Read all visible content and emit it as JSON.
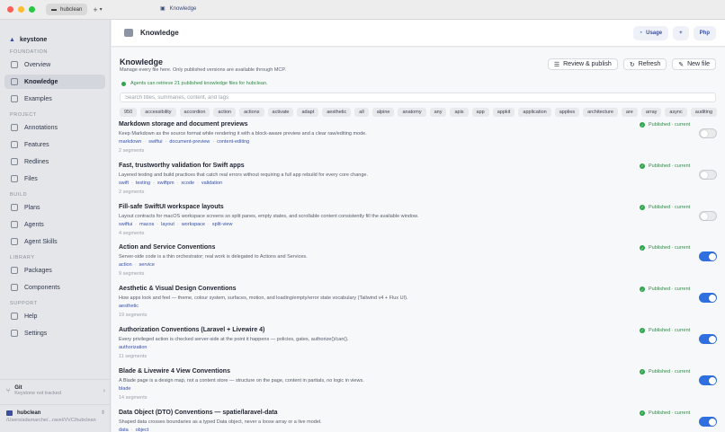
{
  "window": {
    "tab_label": "hubclean",
    "crumb_label": "Knowledge"
  },
  "sidebar": {
    "brand": "keystone",
    "sections": [
      {
        "label": "FOUNDATION",
        "items": [
          "Overview",
          "Knowledge",
          "Examples"
        ]
      },
      {
        "label": "PROJECT",
        "items": [
          "Annotations",
          "Features",
          "Redlines",
          "Files"
        ]
      },
      {
        "label": "BUILD",
        "items": [
          "Plans",
          "Agents",
          "Agent Skills"
        ]
      },
      {
        "label": "LIBRARY",
        "items": [
          "Packages",
          "Components"
        ]
      },
      {
        "label": "SUPPORT",
        "items": [
          "Help",
          "Settings"
        ]
      }
    ],
    "active_item": "Knowledge",
    "git": {
      "title": "Git",
      "status": "Keystone not tracked"
    },
    "project": {
      "name": "hubclean",
      "path": "/Users/adamarche/...ravel/VVC/hubclean"
    }
  },
  "header": {
    "title": "Knowledge",
    "usage_label": "Usage",
    "plus_label": "+",
    "php_label": "Php"
  },
  "page": {
    "title": "Knowledge",
    "subtitle": "Manage every file here. Only published versions are available through MCP.",
    "review_label": "Review & publish",
    "refresh_label": "Refresh",
    "new_file_label": "New file",
    "notice": "Agents can retrieve 21 published knowledge files for hubclean.",
    "search_placeholder": "Search titles, summaries, content, and tags"
  },
  "tags": [
    "950",
    "accessibility",
    "accordion",
    "action",
    "actions",
    "activate",
    "adapt",
    "aesthetic",
    "all",
    "alpine",
    "anatomy",
    "any",
    "apis",
    "app",
    "appkit",
    "application",
    "applies",
    "architecture",
    "are",
    "array",
    "async",
    "auditing"
  ],
  "items": [
    {
      "title": "Markdown storage and document previews",
      "desc": "Keep Markdown as the source format while rendering it with a block-aware preview and a clear raw/editing mode.",
      "tags": [
        "markdown",
        "swiftui",
        "document-preview",
        "content-editing"
      ],
      "segments": "2 segments",
      "status": "Published · current",
      "enabled": false
    },
    {
      "title": "Fast, trustworthy validation for Swift apps",
      "desc": "Layered testing and build practices that catch real errors without requiring a full app rebuild for every core change.",
      "tags": [
        "swift",
        "testing",
        "swiftpm",
        "xcode",
        "validation"
      ],
      "segments": "2 segments",
      "status": "Published · current",
      "enabled": false
    },
    {
      "title": "Fill-safe SwiftUI workspace layouts",
      "desc": "Layout contracts for macOS workspace screens so split panes, empty states, and scrollable content consistently fill the available window.",
      "tags": [
        "swiftui",
        "macos",
        "layout",
        "workspace",
        "split-view"
      ],
      "segments": "4 segments",
      "status": "Published · current",
      "enabled": false
    },
    {
      "title": "Action and Service Conventions",
      "desc": "Server-side code is a thin orchestrator; real work is delegated to Actions and Services.",
      "tags": [
        "action",
        "service"
      ],
      "segments": "9 segments",
      "status": "Published · current",
      "enabled": true
    },
    {
      "title": "Aesthetic & Visual Design Conventions",
      "desc": "How apps look and feel — theme, colour system, surfaces, motion, and loading/empty/error state vocabulary (Tailwind v4 + Flux UI).",
      "tags": [
        "aesthetic"
      ],
      "segments": "19 segments",
      "status": "Published · current",
      "enabled": true
    },
    {
      "title": "Authorization Conventions (Laravel + Livewire 4)",
      "desc": "Every privileged action is checked server-side at the point it happens — policies, gates, authorize()/can().",
      "tags": [
        "authorization"
      ],
      "segments": "11 segments",
      "status": "Published · current",
      "enabled": true
    },
    {
      "title": "Blade & Livewire 4 View Conventions",
      "desc": "A Blade page is a design map, not a content store — structure on the page, content in partials, no logic in views.",
      "tags": [
        "blade"
      ],
      "segments": "14 segments",
      "status": "Published · current",
      "enabled": true
    },
    {
      "title": "Data Object (DTO) Conventions — spatie/laravel-data",
      "desc": "Shaped data crosses boundaries as a typed Data object, never a loose array or a live model.",
      "tags": [
        "data",
        "object"
      ],
      "segments": "",
      "status": "Published · current",
      "enabled": true
    }
  ]
}
